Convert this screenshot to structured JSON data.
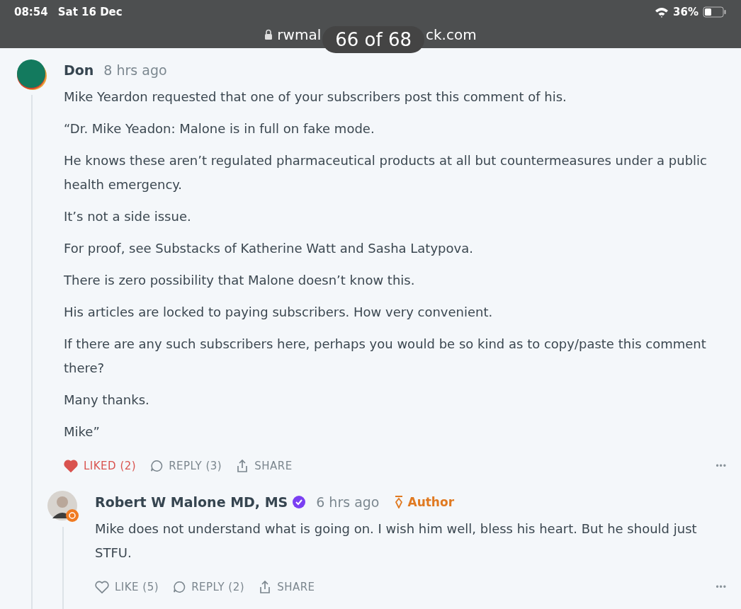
{
  "status_bar": {
    "time": "08:54",
    "date": "Sat 16 Dec",
    "battery": "36%"
  },
  "address_bar": {
    "url_visible_start": "rwmal",
    "url_visible_end": "ck.com"
  },
  "overlay": {
    "counter": "66 of 68"
  },
  "comments": [
    {
      "author": "Don",
      "time": "8 hrs ago",
      "verified": false,
      "kind": "abstract",
      "paragraphs": [
        "Mike Yeardon requested that one of your subscribers post this comment of his.",
        "“Dr. Mike Yeadon: Malone is in full on fake mode.",
        "He knows these aren’t regulated pharmaceutical products at all but countermeasures under a public health emergency.",
        "It’s not a side issue.",
        "For proof, see Substacks of Katherine Watt and Sasha Latypova.",
        "There is zero possibility that Malone doesn’t know this.",
        "His articles are locked to paying subscribers. How very convenient.",
        "If there are any such subscribers here, perhaps you would be so kind as to copy/paste this comment there?",
        "Many thanks.",
        "Mike”"
      ],
      "actions": [
        {
          "kind": "like",
          "label": "LIKED (2)",
          "on": true
        },
        {
          "kind": "reply",
          "label": "REPLY (3)"
        },
        {
          "kind": "share",
          "label": "SHARE"
        }
      ],
      "more": "•••",
      "children": [
        {
          "author": "Robert W Malone MD, MS",
          "time": "6 hrs ago",
          "verified": true,
          "badge": "Author",
          "kind": "person",
          "paragraphs": [
            "Mike does not understand what is going on. I wish him well, bless his heart. But he should just STFU."
          ],
          "actions": [
            {
              "kind": "like",
              "label": "LIKE (5)",
              "on": false
            },
            {
              "kind": "reply",
              "label": "REPLY (2)"
            },
            {
              "kind": "share",
              "label": "SHARE"
            }
          ],
          "more": "•••"
        }
      ]
    }
  ]
}
